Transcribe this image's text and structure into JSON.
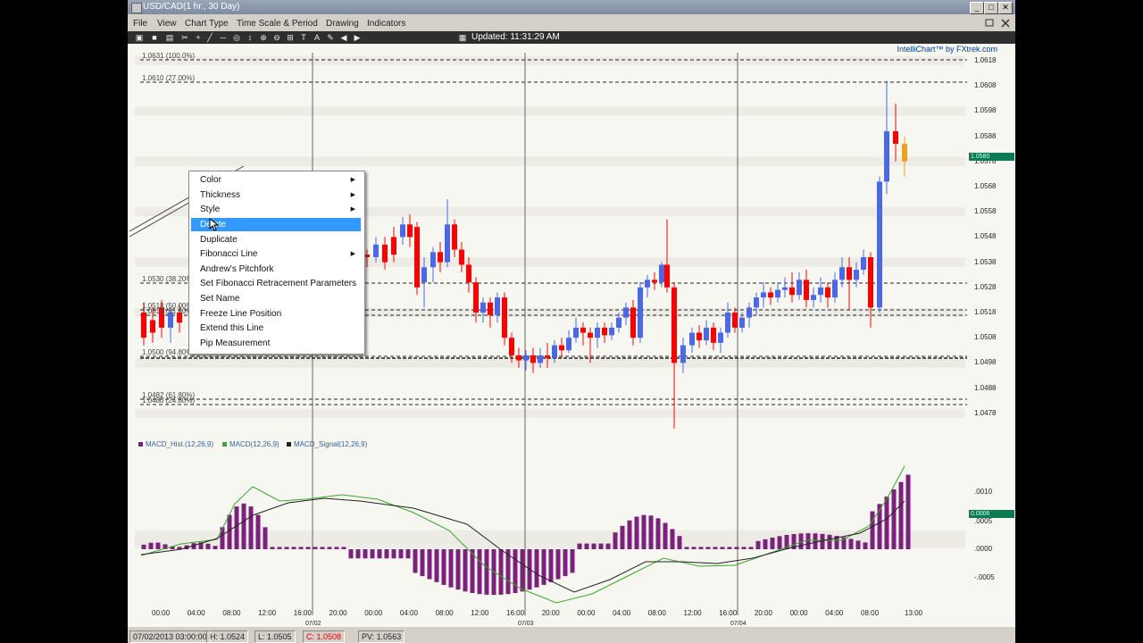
{
  "window": {
    "title": "USD/CAD(1 hr., 30 Day)",
    "controls": [
      "_",
      "□",
      "✕"
    ]
  },
  "menubar": {
    "items": [
      "File",
      "View",
      "Chart Type",
      "Time Scale & Period",
      "Drawing",
      "Indicators"
    ]
  },
  "toolbar": {
    "icons": [
      "print-icon",
      "save-icon",
      "open-icon",
      "cut-icon",
      "crosshair-icon",
      "line-icon",
      "hline-icon",
      "target-icon",
      "arrow-icon",
      "zoom-in-icon",
      "zoom-out-icon",
      "grid-icon",
      "text-icon",
      "font-icon",
      "pencil-icon",
      "back-icon",
      "forward-icon",
      "fit-icon"
    ],
    "updated": "Updated: 11:31:29 AM"
  },
  "chart": {
    "brand": "IntelliChart™ by FXtrek.com",
    "price_labels": [
      {
        "text": "1.0631 (100.0%)"
      },
      {
        "text": "1.0610 (27.00%)"
      },
      {
        "text": "1.0530 (38.20%)"
      },
      {
        "text": "1.0518 (50.00%)"
      },
      {
        "text": "1.0515 (61.80%)"
      },
      {
        "text": "1.0500 (94.80%)"
      },
      {
        "text": "1.0482 (61.80%)"
      },
      {
        "text": "1.0480 (24.80%)"
      }
    ],
    "y_labels": [
      "1.0618",
      "1.0608",
      "1.0598",
      "1.0588",
      "1.0578",
      "1.0568",
      "1.0558",
      "1.0548",
      "1.0538",
      "1.0528",
      "1.0518",
      "1.0508",
      "1.0498",
      "1.0488",
      "1.0478"
    ],
    "price_tag": "1.0580",
    "macd_tag": "0.0006",
    "macd_legend": [
      "MACD_Hist.(12,26,9)",
      "MACD(12,26,9)",
      "MACD_Signal(12,26,9)"
    ],
    "macd_y_labels": [
      ".0010",
      ".0005",
      ".0000",
      "-.0005"
    ],
    "x_labels": [
      "00:00",
      "04:00",
      "08:00",
      "12:00",
      "16:00",
      "20:00",
      "00:00",
      "04:00",
      "08:00",
      "12:00",
      "16:00",
      "20:00",
      "00:00",
      "04:00",
      "08:00",
      "12:00",
      "16:00",
      "20:00",
      "00:00",
      "04:00",
      "08:00",
      "13:00"
    ],
    "date_labels": [
      "07/02",
      "07/03",
      "07/04"
    ],
    "colors": {
      "up": "#ff0000",
      "down": "#4a68e8",
      "last": "#f0a020",
      "macd_hist": "#7d1f7d",
      "macd": "#3aa82a",
      "signal": "#222222"
    }
  },
  "context_menu": {
    "items": [
      {
        "label": "Color",
        "submenu": true
      },
      {
        "label": "Thickness",
        "submenu": true
      },
      {
        "label": "Style",
        "submenu": true
      },
      {
        "label": "Delete",
        "submenu": false,
        "selected": true
      },
      {
        "label": "Duplicate",
        "submenu": false
      },
      {
        "label": "Fibonacci Line",
        "submenu": true
      },
      {
        "label": "Andrew's Pitchfork",
        "submenu": false
      },
      {
        "label": "Set Fibonacci Retracement Parameters",
        "submenu": false
      },
      {
        "label": "Set Name",
        "submenu": false
      },
      {
        "label": "Freeze Line Position",
        "submenu": false
      },
      {
        "label": "Extend this Line",
        "submenu": false
      },
      {
        "label": "Pip Measurement",
        "submenu": false
      }
    ]
  },
  "statusbar": {
    "items": [
      "07/02/2013 03:00:00",
      "H: 1.0524",
      "L: 1.0505",
      "C: 1.0508",
      "PV: 1.0563"
    ]
  }
}
